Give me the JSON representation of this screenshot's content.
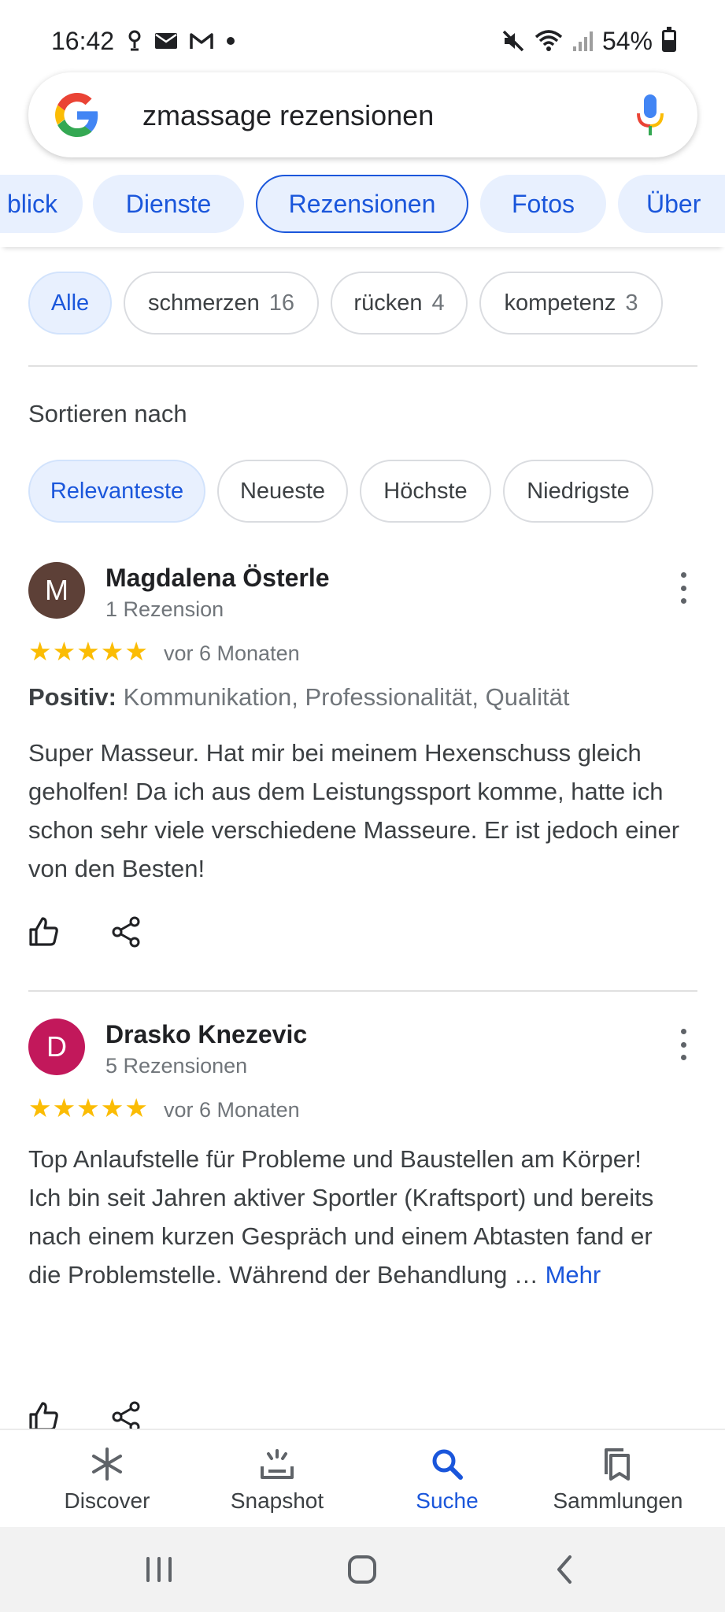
{
  "status_bar": {
    "time": "16:42",
    "battery": "54%",
    "battery_level": 0.54,
    "icons": [
      "location-icon",
      "mail-icon",
      "gmail-icon",
      "dot-icon",
      "mute-icon",
      "wifi-icon",
      "signal-icon",
      "battery-icon"
    ]
  },
  "search": {
    "query": "zmassage rezensionen",
    "icons": [
      "google-logo",
      "mic-icon"
    ]
  },
  "tabs": [
    {
      "label": "blick"
    },
    {
      "label": "Dienste"
    },
    {
      "label": "Rezensionen",
      "active": true
    },
    {
      "label": "Fotos"
    },
    {
      "label": "Über"
    }
  ],
  "filters": [
    {
      "label": "Alle",
      "count": "",
      "selected": true
    },
    {
      "label": "schmerzen",
      "count": "16"
    },
    {
      "label": "rücken",
      "count": "4"
    },
    {
      "label": "kompetenz",
      "count": "3"
    }
  ],
  "sort": {
    "label": "Sortieren nach",
    "options": [
      {
        "label": "Relevanteste",
        "selected": true
      },
      {
        "label": "Neueste"
      },
      {
        "label": "Höchste"
      },
      {
        "label": "Niedrigste"
      }
    ]
  },
  "reviews": [
    {
      "initial": "M",
      "avatar_color": "#5d4037",
      "name": "Magdalena Österle",
      "review_count": "1 Rezension",
      "rating": 5,
      "stars": "★★★★★",
      "time": "vor 6 Monaten",
      "positive_label": "Positiv:",
      "positive_text": "Kommunikation, Professionalität, Qualität",
      "text": "Super Masseur. Hat mir bei meinem Hexenschuss gleich geholfen! Da ich aus dem Leistungssport komme, hatte ich schon sehr viele verschiedene Masseure. Er ist jedoch einer von den Besten!"
    },
    {
      "initial": "D",
      "avatar_color": "#c2185b",
      "name": "Drasko Knezevic",
      "review_count": "5 Rezensionen",
      "rating": 5,
      "stars": "★★★★★",
      "time": "vor 6 Monaten",
      "text_line1": "Top Anlaufstelle für Probleme und Baustellen am Körper!",
      "text_line2": "Ich bin seit Jahren aktiver Sportler (Kraftsport) und bereits nach einem kurzen Gespräch und einem Abtasten fand er die Problemstelle. Während der Behandlung …",
      "more": "Mehr"
    }
  ],
  "bottom_nav": [
    {
      "label": "Discover",
      "icon": "asterisk-icon"
    },
    {
      "label": "Snapshot",
      "icon": "snapshot-icon"
    },
    {
      "label": "Suche",
      "icon": "search-icon",
      "active": true
    },
    {
      "label": "Sammlungen",
      "icon": "collections-icon"
    }
  ],
  "colors": {
    "accent": "#1a56db",
    "chip_bg": "#e8f0fe",
    "star": "#fbbc04"
  }
}
